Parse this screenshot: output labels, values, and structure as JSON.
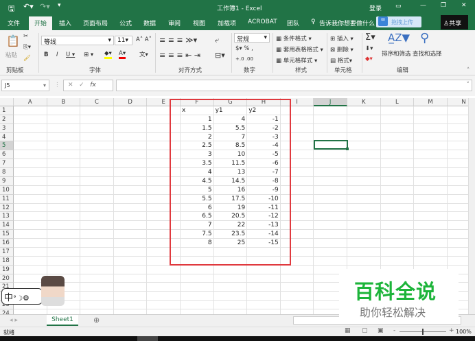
{
  "title": "工作簿1 - Excel",
  "title_right": {
    "login": "登录"
  },
  "tabs": [
    "文件",
    "开始",
    "插入",
    "页面布局",
    "公式",
    "数据",
    "审阅",
    "视图",
    "加载项",
    "ACROBAT",
    "团队"
  ],
  "tell_me": "告诉我你想要做什么",
  "upload": "拖拽上传",
  "share": "共享",
  "ribbon": {
    "paste": "粘贴",
    "font_name": "等线",
    "font_size": "11",
    "number_format": "常规",
    "cond_format": "条件格式",
    "table_format": "套用表格格式",
    "cell_style": "单元格样式",
    "insert": "插入",
    "delete": "删除",
    "format": "格式",
    "sort": "排序和筛选",
    "find": "查找和选择",
    "groups": [
      "剪贴板",
      "字体",
      "对齐方式",
      "数字",
      "样式",
      "单元格",
      "编辑"
    ]
  },
  "name_box": "J5",
  "columns": [
    "A",
    "B",
    "C",
    "D",
    "E",
    "F",
    "G",
    "H",
    "I",
    "J",
    "K",
    "L",
    "M",
    "N"
  ],
  "rows": 24,
  "table": {
    "headers": [
      "x",
      "y1",
      "y2"
    ],
    "data": [
      [
        "1",
        "4",
        "-1"
      ],
      [
        "1.5",
        "5.5",
        "-2"
      ],
      [
        "2",
        "7",
        "-3"
      ],
      [
        "2.5",
        "8.5",
        "-4"
      ],
      [
        "3",
        "10",
        "-5"
      ],
      [
        "3.5",
        "11.5",
        "-6"
      ],
      [
        "4",
        "13",
        "-7"
      ],
      [
        "4.5",
        "14.5",
        "-8"
      ],
      [
        "5",
        "16",
        "-9"
      ],
      [
        "5.5",
        "17.5",
        "-10"
      ],
      [
        "6",
        "19",
        "-11"
      ],
      [
        "6.5",
        "20.5",
        "-12"
      ],
      [
        "7",
        "22",
        "-13"
      ],
      [
        "7.5",
        "23.5",
        "-14"
      ],
      [
        "8",
        "25",
        "-15"
      ]
    ]
  },
  "sheet_tab": "Sheet1",
  "status": "就绪",
  "zoom": "100%",
  "ime": "中",
  "watermark": {
    "title": "百科全说",
    "subtitle": "助你轻松解决"
  },
  "colors": {
    "excel_green": "#217346",
    "red_box": "#e0393e",
    "watermark_green": "#1db43a"
  }
}
